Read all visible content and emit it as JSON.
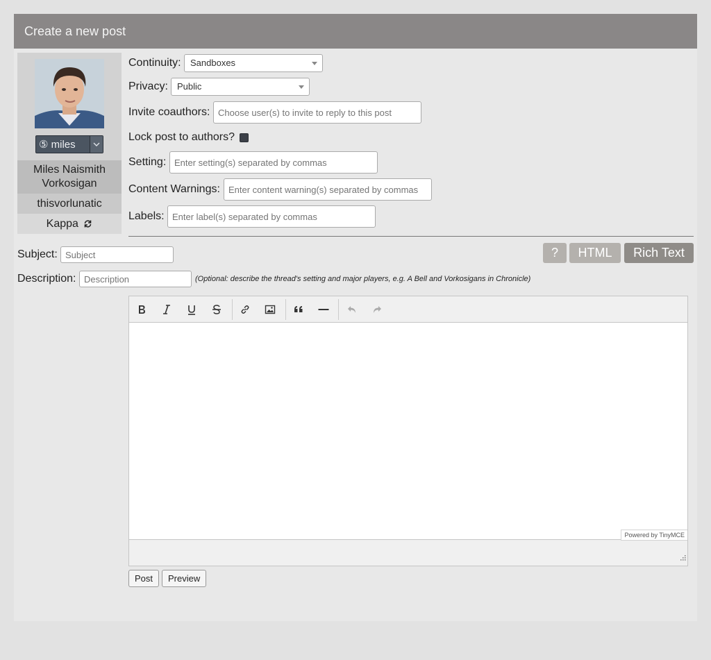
{
  "header": {
    "title": "Create a new post"
  },
  "character": {
    "alias_selected": "⑤ miles",
    "name": "Miles Naismith Vorkosigan",
    "screenname": "thisvorlunatic",
    "template": "Kappa"
  },
  "fields": {
    "continuity_label": "Continuity:",
    "continuity_value": "Sandboxes",
    "privacy_label": "Privacy:",
    "privacy_value": "Public",
    "coauthors_label": "Invite coauthors:",
    "coauthors_placeholder": "Choose user(s) to invite to reply to this post",
    "lock_label": "Lock post to authors?",
    "setting_label": "Setting:",
    "setting_placeholder": "Enter setting(s) separated by commas",
    "warnings_label": "Content Warnings:",
    "warnings_placeholder": "Enter content warning(s) separated by commas",
    "labels_label": "Labels:",
    "labels_placeholder": "Enter label(s) separated by commas",
    "subject_label": "Subject:",
    "subject_placeholder": "Subject",
    "description_label": "Description:",
    "description_placeholder": "Description",
    "description_hint": "(Optional: describe the thread's setting and major players, e.g. A Bell and Vorkosigans in Chronicle)"
  },
  "editor_modes": {
    "help": "?",
    "html": "HTML",
    "rich": "Rich Text"
  },
  "editor": {
    "powered_by": "Powered by TinyMCE"
  },
  "actions": {
    "post": "Post",
    "preview": "Preview"
  },
  "colors": {
    "header_bg": "#8a8787",
    "mode_inactive": "#b4b1ad",
    "mode_active": "#8f8c88"
  }
}
